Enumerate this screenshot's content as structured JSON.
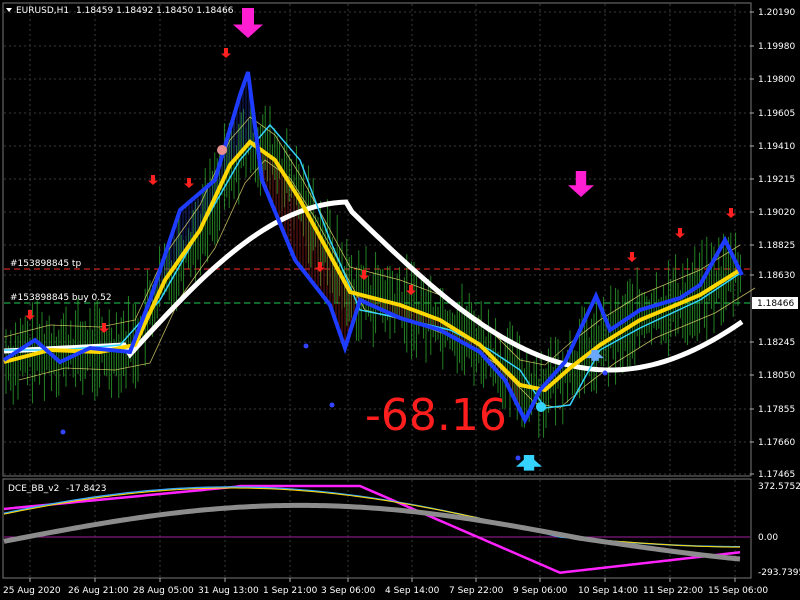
{
  "main_header": {
    "symbol_tf": "EURUSD,H1",
    "ohlc": "1.18459 1.18492 1.18450 1.18466"
  },
  "sub_header": {
    "indicator": "DCE_BB_v2",
    "value": "-17.8423"
  },
  "order_lines": [
    {
      "label": "#153898845 tp",
      "price": 1.1867,
      "color": "#ff2a2a"
    },
    {
      "label": "#153898845 buy 0.52",
      "price": 1.18466,
      "color": "#22cc55"
    }
  ],
  "price_axis": {
    "ticks": [
      "1.20190",
      "1.19980",
      "1.19800",
      "1.19605",
      "1.19410",
      "1.19215",
      "1.19020",
      "1.18825",
      "1.18630",
      "1.18466",
      "1.18245",
      "1.18050",
      "1.17855",
      "1.17660",
      "1.17465"
    ],
    "current_price": "1.18466",
    "ylim": [
      1.1742,
      1.2028
    ]
  },
  "sub_axis": {
    "ticks": [
      "372.5752",
      "0.00",
      "-293.7395"
    ]
  },
  "time_axis": {
    "labels": [
      "25 Aug 2020",
      "26 Aug 21:00",
      "28 Aug 05:00",
      "31 Aug 13:00",
      "1 Sep 21:00",
      "3 Sep 06:00",
      "4 Sep 14:00",
      "7 Sep 22:00",
      "9 Sep 06:00",
      "10 Sep 14:00",
      "11 Sep 22:00",
      "15 Sep 06:00"
    ]
  },
  "profit_text": "-68.16",
  "colors": {
    "grid": "#3a3a3a",
    "blue_ma": "#1e3cff",
    "yellow_ma": "#ffd700",
    "white_wave": "#ffffff",
    "cyan": "#35d4ff",
    "magenta_arrow": "#ff1ed2",
    "red_arrow": "#ff2020",
    "green_price": "#2ea82e",
    "osc_magenta": "#ff22ff",
    "osc_grey": "#8c8c8c"
  },
  "chart_data": {
    "type": "line",
    "x": [
      "25 Aug 2020",
      "26 Aug 21:00",
      "28 Aug 05:00",
      "31 Aug 13:00",
      "1 Sep 21:00",
      "3 Sep 06:00",
      "4 Sep 14:00",
      "7 Sep 22:00",
      "9 Sep 06:00",
      "10 Sep 14:00",
      "11 Sep 22:00",
      "15 Sep 06:00"
    ],
    "series": [
      {
        "values": [
          1.1815,
          1.1822,
          1.185,
          1.1985,
          1.1895,
          1.1845,
          1.1832,
          1.1808,
          1.1778,
          1.1846,
          1.1844,
          1.1878
        ]
      },
      {
        "values": [
          1.1812,
          1.1818,
          1.1835,
          1.194,
          1.1895,
          1.1848,
          1.1838,
          1.1815,
          1.1795,
          1.183,
          1.184,
          1.1866
        ]
      },
      {
        "values": [
          1.1822,
          1.1813,
          1.1818,
          1.185,
          1.1895,
          1.1905,
          1.1875,
          1.1828,
          1.181,
          1.1808,
          1.181,
          1.1838
        ]
      }
    ]
  }
}
